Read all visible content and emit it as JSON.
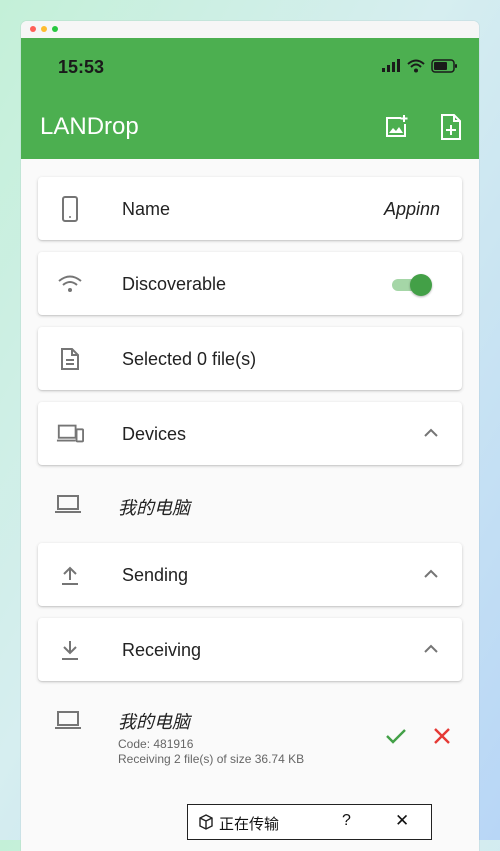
{
  "status_bar": {
    "time": "15:53"
  },
  "appbar": {
    "title": "LANDrop",
    "accent": "#4caf50",
    "actions": [
      {
        "icon": "add-photo-icon"
      },
      {
        "icon": "add-file-icon"
      }
    ]
  },
  "settings": {
    "name": {
      "label": "Name",
      "value": "Appinn",
      "icon": "phone-icon"
    },
    "discoverable": {
      "label": "Discoverable",
      "enabled": true,
      "icon": "wifi-icon"
    },
    "selected": {
      "label": "Selected 0 file(s)",
      "icon": "document-icon"
    }
  },
  "sections": {
    "devices": {
      "label": "Devices",
      "icon": "devices-icon",
      "expanded": true,
      "items": [
        {
          "name": "我的电脑"
        }
      ]
    },
    "sending": {
      "label": "Sending",
      "icon": "upload-icon",
      "expanded": true
    },
    "receiving": {
      "label": "Receiving",
      "icon": "download-icon",
      "expanded": true,
      "items": [
        {
          "name": "我的电脑",
          "code": "Code: 481916",
          "detail": "Receiving 2 file(s) of size 36.74 KB"
        }
      ]
    }
  },
  "toast": {
    "text": "正在传输",
    "help": "?",
    "close": "✕"
  }
}
